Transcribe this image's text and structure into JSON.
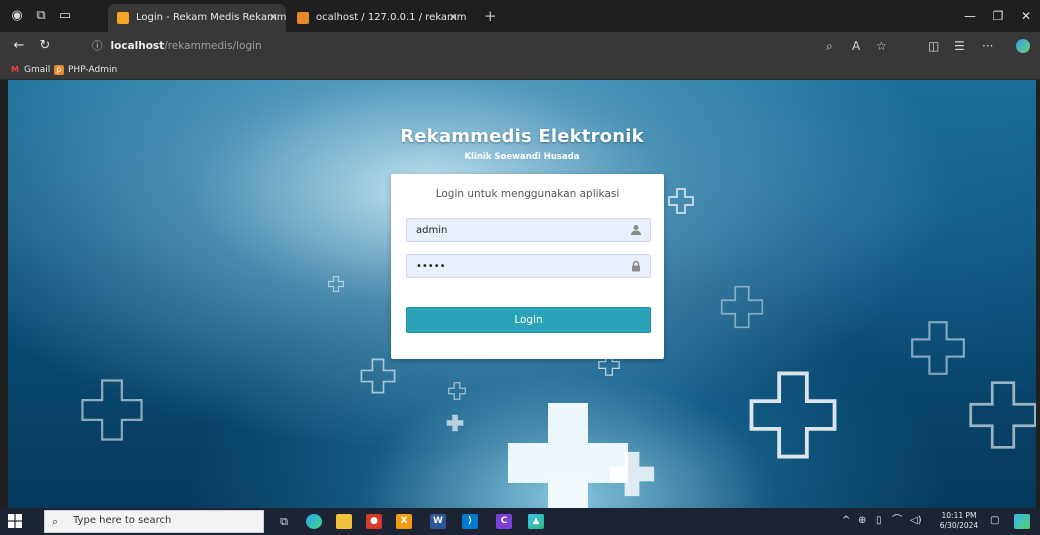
{
  "browser": {
    "tabs": [
      {
        "title": "Login - Rekam Medis Rekammedi",
        "active": true
      },
      {
        "title": "ocalhost / 127.0.0.1 / rekammed",
        "active": false
      }
    ],
    "new_tab_label": "+",
    "address": {
      "host": "localhost",
      "path": "/rekammedis/login"
    },
    "bookmarks": [
      {
        "label": "Gmail",
        "icon": "gmail-icon"
      },
      {
        "label": "PHP-Admin",
        "icon": "phpmyadmin-icon"
      }
    ]
  },
  "page": {
    "title": "Rekammedis Elektronik",
    "subtitle": "Klinik Soewandi Husada",
    "login": {
      "message": "Login untuk menggunakan aplikasi",
      "username_value": "admin",
      "password_value": "•••••",
      "button_label": "Login"
    }
  },
  "taskbar": {
    "search_placeholder": "Type here to search",
    "time": "10:11 PM",
    "date": "6/30/2024"
  },
  "colors": {
    "login_button": "#2aa3b8",
    "background_blue": "#0b4f79",
    "taskbar": "#1c2433"
  }
}
